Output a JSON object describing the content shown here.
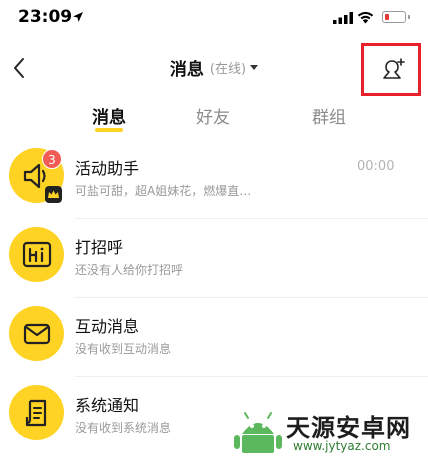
{
  "status_bar": {
    "time": "23:09",
    "icons": [
      "location-arrow-icon",
      "signal-icon",
      "wifi-icon",
      "battery-low-icon"
    ]
  },
  "nav": {
    "back_icon": "chevron-left-icon",
    "title": "消息",
    "subtitle": "(在线)",
    "dropdown_icon": "caret-down-icon",
    "add_friend_icon": "add-user-icon",
    "highlight_color": "#e8202a"
  },
  "tabs": [
    {
      "label": "消息",
      "active": true
    },
    {
      "label": "好友",
      "active": false
    },
    {
      "label": "群组",
      "active": false
    }
  ],
  "accent_color": "#ffd324",
  "messages": [
    {
      "title": "活动助手",
      "subtitle": "可盐可甜，超A姐妹花，燃爆直…",
      "time": "00:00",
      "badge": "3",
      "icon": "megaphone-icon"
    },
    {
      "title": "打招呼",
      "subtitle": "还没有人给你打招呼",
      "icon": "hi-icon"
    },
    {
      "title": "互动消息",
      "subtitle": "没有收到互动消息",
      "icon": "envelope-icon"
    },
    {
      "title": "系统通知",
      "subtitle": "没有收到系统消息",
      "icon": "document-icon"
    }
  ],
  "watermark": {
    "brand": "天源安卓网",
    "url": "www.jytyaz.com"
  }
}
